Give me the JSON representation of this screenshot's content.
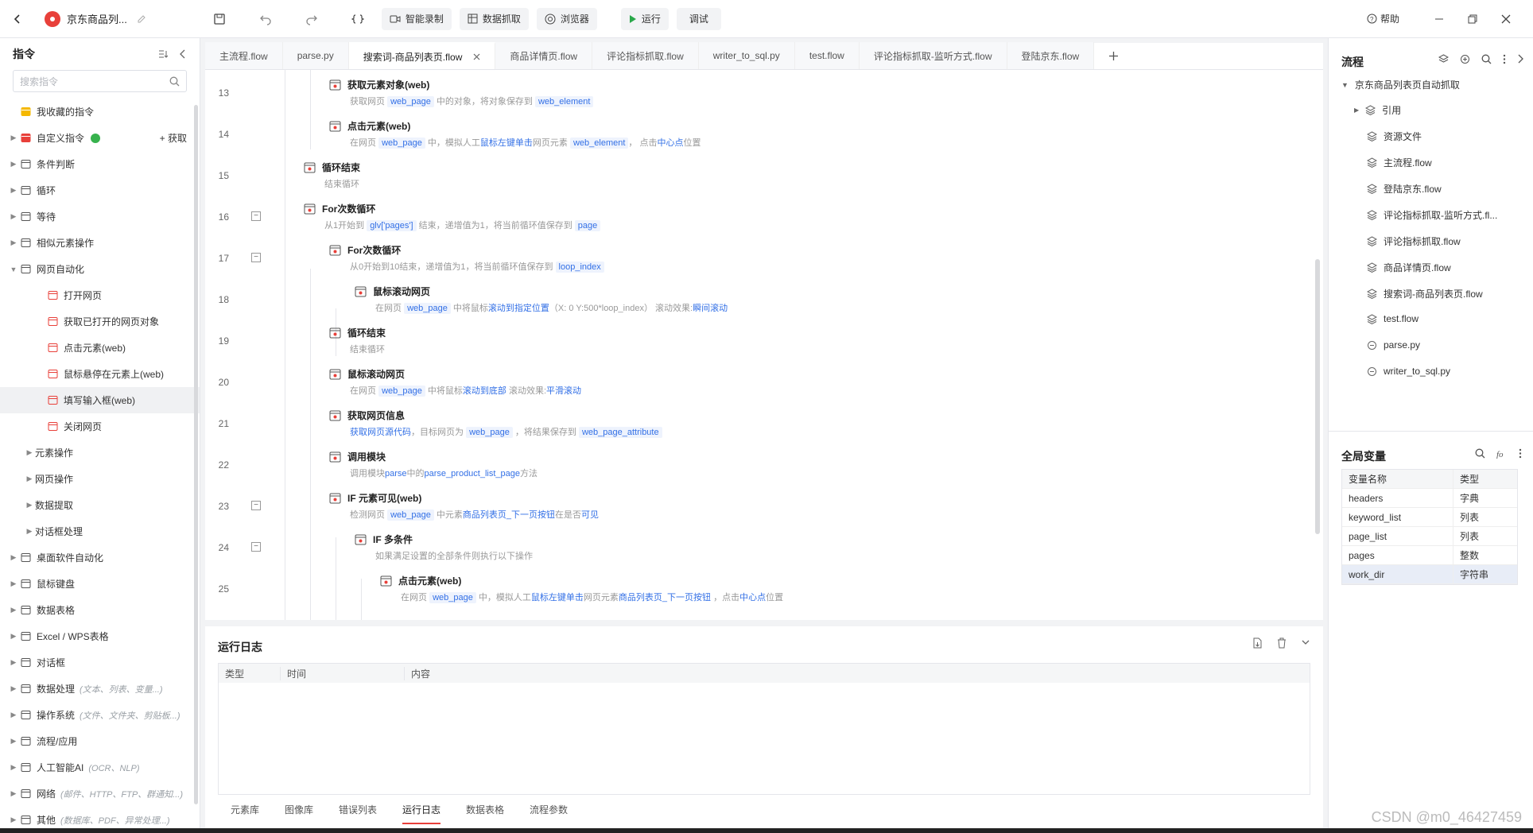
{
  "app": {
    "title": "京东商品列...",
    "buttons": {
      "record": "智能录制",
      "scrape": "数据抓取",
      "browser": "浏览器",
      "run": "运行",
      "debug": "调试",
      "help": "帮助"
    }
  },
  "left": {
    "title": "指令",
    "search_placeholder": "搜索指令",
    "items": [
      {
        "label": "我收藏的指令",
        "level": 0,
        "icon": "heart-icon"
      },
      {
        "label": "自定义指令",
        "level": 0,
        "icon": "custom-icon",
        "extra": "+ 获取",
        "arrow": true
      },
      {
        "label": "条件判断",
        "level": 0,
        "icon": "branch-icon",
        "arrow": true
      },
      {
        "label": "循环",
        "level": 0,
        "icon": "loop-icon",
        "arrow": true
      },
      {
        "label": "等待",
        "level": 0,
        "icon": "hourglass-icon",
        "arrow": true
      },
      {
        "label": "相似元素操作",
        "level": 0,
        "icon": "copy-icon",
        "arrow": true
      },
      {
        "label": "网页自动化",
        "level": 0,
        "icon": "globe-icon",
        "arrow": true,
        "open": true
      },
      {
        "label": "打开网页",
        "level": 2,
        "icon": "web-icon"
      },
      {
        "label": "获取已打开的网页对象",
        "level": 2,
        "icon": "web-icon"
      },
      {
        "label": "点击元素(web)",
        "level": 2,
        "icon": "web-icon"
      },
      {
        "label": "鼠标悬停在元素上(web)",
        "level": 2,
        "icon": "web-icon"
      },
      {
        "label": "填写输入框(web)",
        "level": 2,
        "icon": "web-icon",
        "sel": true
      },
      {
        "label": "关闭网页",
        "level": 2,
        "icon": "web-icon"
      },
      {
        "label": "元素操作",
        "level": 1,
        "arrow": true
      },
      {
        "label": "网页操作",
        "level": 1,
        "arrow": true
      },
      {
        "label": "数据提取",
        "level": 1,
        "arrow": true
      },
      {
        "label": "对话框处理",
        "level": 1,
        "arrow": true
      },
      {
        "label": "桌面软件自动化",
        "level": 0,
        "icon": "desktop-icon",
        "arrow": true
      },
      {
        "label": "鼠标键盘",
        "level": 0,
        "icon": "mouse-icon",
        "arrow": true
      },
      {
        "label": "数据表格",
        "level": 0,
        "icon": "table-icon",
        "arrow": true
      },
      {
        "label": "Excel / WPS表格",
        "level": 0,
        "icon": "excel-icon",
        "arrow": true
      },
      {
        "label": "对话框",
        "level": 0,
        "icon": "dialog-icon",
        "arrow": true
      },
      {
        "label": "数据处理",
        "level": 0,
        "icon": "data-icon",
        "arrow": true,
        "sub": "(文本、列表、变量...)"
      },
      {
        "label": "操作系统",
        "level": 0,
        "icon": "os-icon",
        "arrow": true,
        "sub": "(文件、文件夹、剪贴板...)"
      },
      {
        "label": "流程/应用",
        "level": 0,
        "icon": "layers-icon",
        "arrow": true
      },
      {
        "label": "人工智能AI",
        "level": 0,
        "icon": "ai-icon",
        "arrow": true,
        "sub": "(OCR、NLP)"
      },
      {
        "label": "网络",
        "level": 0,
        "icon": "network-icon",
        "arrow": true,
        "sub": "(邮件、HTTP、FTP、群通知...)"
      },
      {
        "label": "其他",
        "level": 0,
        "icon": "other-icon",
        "arrow": true,
        "sub": "(数据库、PDF、异常处理...)"
      }
    ]
  },
  "tabs": [
    "主流程.flow",
    "parse.py",
    "搜索词-商品列表页.flow",
    "商品详情页.flow",
    "评论指标抓取.flow",
    "writer_to_sql.py",
    "test.flow",
    "评论指标抓取-监听方式.flow",
    "登陆京东.flow"
  ],
  "active_tab": 2,
  "steps": [
    {
      "n": "13",
      "indent": 1,
      "title": "获取元素对象(web)",
      "desc": [
        [
          "t",
          "获取网页 "
        ],
        [
          "v",
          "web_page"
        ],
        [
          "t",
          " 中的对象，将对象保存到 "
        ],
        [
          "v",
          "web_element"
        ]
      ]
    },
    {
      "n": "14",
      "indent": 1,
      "title": "点击元素(web)",
      "desc": [
        [
          "t",
          "在网页 "
        ],
        [
          "v",
          "web_page"
        ],
        [
          "t",
          " 中，模拟人工"
        ],
        [
          "h",
          "鼠标左键单击"
        ],
        [
          "t",
          "网页元素 "
        ],
        [
          "v",
          "web_element"
        ],
        [
          "t",
          "， 点击"
        ],
        [
          "h",
          "中心点"
        ],
        [
          "t",
          "位置"
        ]
      ]
    },
    {
      "n": "15",
      "indent": 0,
      "title": "循环结束",
      "desc": [
        [
          "t",
          "结束循环"
        ]
      ]
    },
    {
      "n": "16",
      "indent": 0,
      "title": "For次数循环",
      "fold": true,
      "desc": [
        [
          "t",
          "从1开始到 "
        ],
        [
          "v",
          "glv['pages']"
        ],
        [
          "t",
          " 结束，递增值为1，将当前循环值保存到 "
        ],
        [
          "v",
          "page"
        ]
      ]
    },
    {
      "n": "17",
      "indent": 1,
      "title": "For次数循环",
      "fold": true,
      "desc": [
        [
          "t",
          "从0开始到10结束，递增值为1，将当前循环值保存到 "
        ],
        [
          "v",
          "loop_index"
        ]
      ]
    },
    {
      "n": "18",
      "indent": 2,
      "title": "鼠标滚动网页",
      "desc": [
        [
          "t",
          "在网页 "
        ],
        [
          "v",
          "web_page"
        ],
        [
          "t",
          " 中将鼠标"
        ],
        [
          "h",
          "滚动到指定位置"
        ],
        [
          "t",
          "（X: 0 Y:500*loop_index） 滚动效果:"
        ],
        [
          "h",
          "瞬间滚动"
        ]
      ]
    },
    {
      "n": "19",
      "indent": 1,
      "title": "循环结束",
      "desc": [
        [
          "t",
          "结束循环"
        ]
      ]
    },
    {
      "n": "20",
      "indent": 1,
      "title": "鼠标滚动网页",
      "desc": [
        [
          "t",
          "在网页 "
        ],
        [
          "v",
          "web_page"
        ],
        [
          "t",
          " 中将鼠标"
        ],
        [
          "h",
          "滚动到底部"
        ],
        [
          "t",
          " 滚动效果:"
        ],
        [
          "h",
          "平滑滚动"
        ]
      ]
    },
    {
      "n": "21",
      "indent": 1,
      "title": "获取网页信息",
      "desc": [
        [
          "h",
          "获取网页源代码"
        ],
        [
          "t",
          "，目标网页为 "
        ],
        [
          "v",
          "web_page"
        ],
        [
          "t",
          " ，将结果保存到 "
        ],
        [
          "v",
          "web_page_attribute"
        ]
      ]
    },
    {
      "n": "22",
      "indent": 1,
      "title": "调用模块",
      "desc": [
        [
          "t",
          "调用模块"
        ],
        [
          "h",
          "parse"
        ],
        [
          "t",
          "中的"
        ],
        [
          "h",
          "parse_product_list_page"
        ],
        [
          "t",
          "方法"
        ]
      ]
    },
    {
      "n": "23",
      "indent": 1,
      "title": "IF 元素可见(web)",
      "fold": true,
      "desc": [
        [
          "t",
          "检测网页 "
        ],
        [
          "v",
          "web_page"
        ],
        [
          "t",
          " 中元素"
        ],
        [
          "h",
          "商品列表页_下一页按钮"
        ],
        [
          "t",
          "在是否"
        ],
        [
          "h",
          "可见"
        ]
      ]
    },
    {
      "n": "24",
      "indent": 2,
      "title": "IF 多条件",
      "fold": true,
      "desc": [
        [
          "t",
          "如果满足设置的全部条件则执行以下操作"
        ]
      ]
    },
    {
      "n": "25",
      "indent": 3,
      "title": "点击元素(web)",
      "desc": [
        [
          "t",
          "在网页 "
        ],
        [
          "v",
          "web_page"
        ],
        [
          "t",
          " 中，模拟人工"
        ],
        [
          "h",
          "鼠标左键单击"
        ],
        [
          "t",
          "网页元素"
        ],
        [
          "h",
          "商品列表页_下一页按钮"
        ],
        [
          "t",
          " ，点击"
        ],
        [
          "h",
          "中心点"
        ],
        [
          "t",
          "位置"
        ]
      ]
    }
  ],
  "log": {
    "title": "运行日志",
    "cols": [
      "类型",
      "时间",
      "内容"
    ],
    "bottom_tabs": [
      "元素库",
      "图像库",
      "错误列表",
      "运行日志",
      "数据表格",
      "流程参数"
    ],
    "active": 3
  },
  "right": {
    "title": "流程",
    "root": "京东商品列表页自动抓取",
    "files": [
      "引用",
      "资源文件",
      "主流程.flow",
      "登陆京东.flow",
      "评论指标抓取-监听方式.fl...",
      "评论指标抓取.flow",
      "商品详情页.flow",
      "搜索词-商品列表页.flow",
      "test.flow",
      "parse.py",
      "writer_to_sql.py"
    ],
    "gv_title": "全局变量",
    "gv_cols": [
      "变量名称",
      "类型"
    ],
    "gv": [
      [
        "headers",
        "字典"
      ],
      [
        "keyword_list",
        "列表"
      ],
      [
        "page_list",
        "列表"
      ],
      [
        "pages",
        "整数"
      ],
      [
        "work_dir",
        "字符串"
      ]
    ]
  },
  "watermark": "CSDN @m0_46427459"
}
